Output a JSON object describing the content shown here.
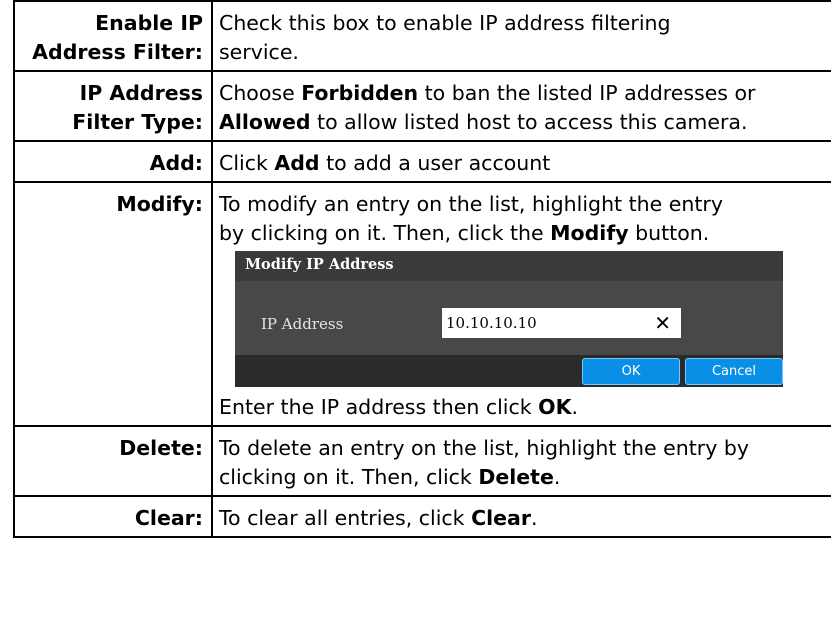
{
  "rows": [
    {
      "term": [
        "Enable IP",
        "Address Filter:"
      ],
      "desc": [
        [
          [
            "Check this box to enable IP address filtering",
            false
          ]
        ],
        [
          [
            "service.",
            false
          ]
        ]
      ]
    },
    {
      "term": [
        "IP Address",
        "Filter Type:"
      ],
      "desc": [
        [
          [
            "Choose ",
            false
          ],
          [
            "Forbidden",
            true
          ],
          [
            " to ban the listed IP addresses or",
            false
          ]
        ],
        [
          [
            "Allowed",
            true
          ],
          [
            " to allow listed host to access this camera.",
            false
          ]
        ]
      ]
    },
    {
      "term": [
        "Add:"
      ],
      "desc": [
        [
          [
            "Click ",
            false
          ],
          [
            "Add",
            true
          ],
          [
            " to add a user account",
            false
          ]
        ]
      ]
    },
    {
      "term": [
        "Modify:"
      ],
      "desc": [
        [
          [
            "To modify an entry on the list, highlight the entry",
            false
          ]
        ],
        [
          [
            "by clicking on it. Then, click the ",
            false
          ],
          [
            "Modify",
            true
          ],
          [
            " button.",
            false
          ]
        ]
      ],
      "after": [
        [
          [
            "Enter the IP address then click ",
            false
          ],
          [
            "OK",
            true
          ],
          [
            ".",
            false
          ]
        ]
      ]
    },
    {
      "term": [
        "Delete:"
      ],
      "desc": [
        [
          [
            "To delete an entry on the list, highlight the entry by",
            false
          ]
        ],
        [
          [
            "clicking on it. Then, click ",
            false
          ],
          [
            "Delete",
            true
          ],
          [
            ".",
            false
          ]
        ]
      ]
    },
    {
      "term": [
        "Clear:"
      ],
      "desc": [
        [
          [
            "To clear all entries, click ",
            false
          ],
          [
            "Clear",
            true
          ],
          [
            ".",
            false
          ]
        ]
      ]
    }
  ],
  "dialog": {
    "title": "Modify IP Address",
    "field_label": "IP Address",
    "field_value": "10.10.10.10",
    "clear_glyph": "✕",
    "ok_label": "OK",
    "cancel_label": "Cancel"
  }
}
